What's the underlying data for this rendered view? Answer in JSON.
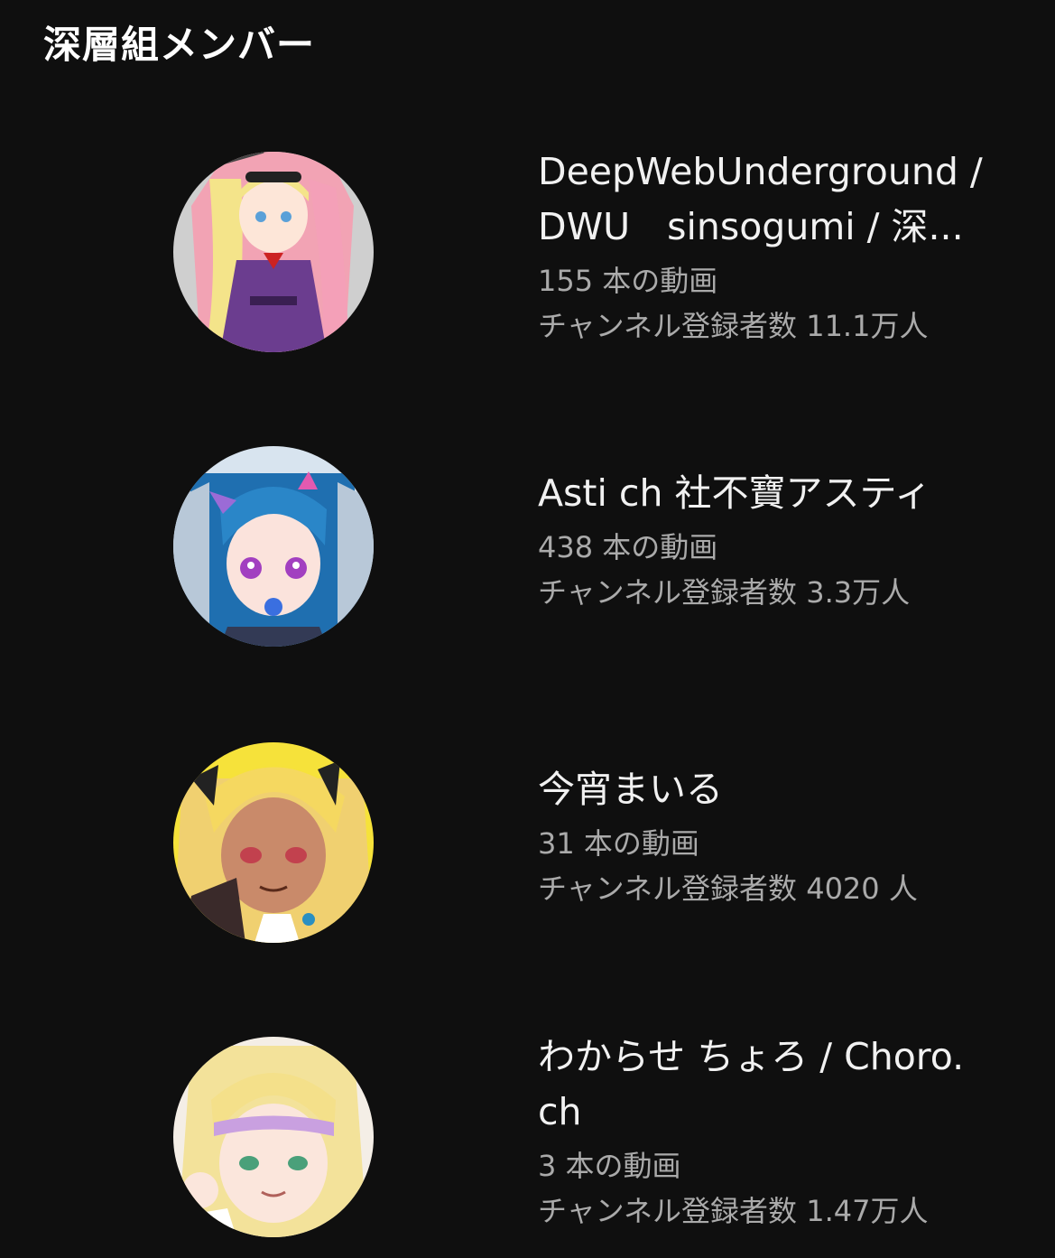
{
  "section": {
    "title": "深層組メンバー"
  },
  "channels": [
    {
      "name_line1": "DeepWebUnderground /",
      "name_line2": "DWU　sinsogumi / 深...",
      "videos": "155 本の動画",
      "subscribers": "チャンネル登録者数 11.1万人",
      "avatar_icon": "avatar-blonde-purple-dress",
      "avatar_bg": "#cfcfcf"
    },
    {
      "name_line1": "Asti ch 社不寶アスティ",
      "videos": "438 本の動画",
      "subscribers": "チャンネル登録者数 3.3万人",
      "avatar_icon": "avatar-blue-hair-bat",
      "avatar_bg": "#cfe0f0"
    },
    {
      "name_line1": "今宵まいる",
      "videos": "31 本の動画",
      "subscribers": "チャンネル登録者数 4020 人",
      "avatar_icon": "avatar-blonde-tan",
      "avatar_bg": "#f6e23a"
    },
    {
      "name_line1": "わからせ ちょろ / Choro.",
      "name_line2": "ch",
      "videos": "3 本の動画",
      "subscribers": "チャンネル登録者数 1.47万人",
      "avatar_icon": "avatar-blonde-pink-tips",
      "avatar_bg": "#f4eee6"
    }
  ]
}
